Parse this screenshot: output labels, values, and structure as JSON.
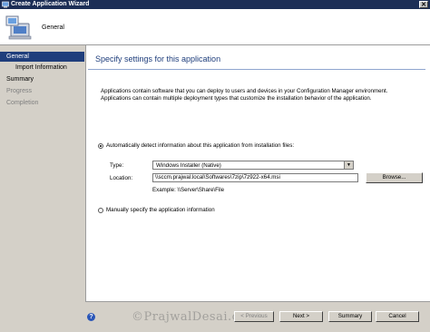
{
  "window": {
    "title": "Create Application Wizard",
    "close_glyph": "✕"
  },
  "header": {
    "title": "General",
    "icon": "computer-icon"
  },
  "nav": {
    "items": [
      {
        "label": "General",
        "state": "active"
      },
      {
        "label": "Import Information",
        "state": "sub"
      },
      {
        "label": "Summary",
        "state": "normal"
      },
      {
        "label": "Progress",
        "state": "disabled"
      },
      {
        "label": "Completion",
        "state": "disabled"
      }
    ]
  },
  "main": {
    "title": "Specify settings for this application",
    "description": "Applications contain software that you can deploy to users and devices in your Configuration Manager environment. Applications can contain multiple deployment types that customize the installation behavior of the application.",
    "auto_detect": {
      "label": "Automatically detect information about this application from installation files:",
      "selected": true
    },
    "type": {
      "label": "Type:",
      "value": "Windows Installer (Native)"
    },
    "location": {
      "label": "Location:",
      "value": "\\\\sccm.prajwal.local\\Softwares\\7zip\\7z922-x64.msi",
      "example": "Example: \\\\Server\\Share\\File"
    },
    "browse_label": "Browse...",
    "manual": {
      "label": "Manually specify the application information",
      "selected": false
    }
  },
  "footer": {
    "previous": "< Previous",
    "next": "Next >",
    "summary": "Summary",
    "cancel": "Cancel",
    "watermark": "©PrajwalDesai.com"
  },
  "colors": {
    "titlebar": "#1c2e56",
    "accent": "#1f3e7c",
    "panel": "#d4d0c8"
  }
}
